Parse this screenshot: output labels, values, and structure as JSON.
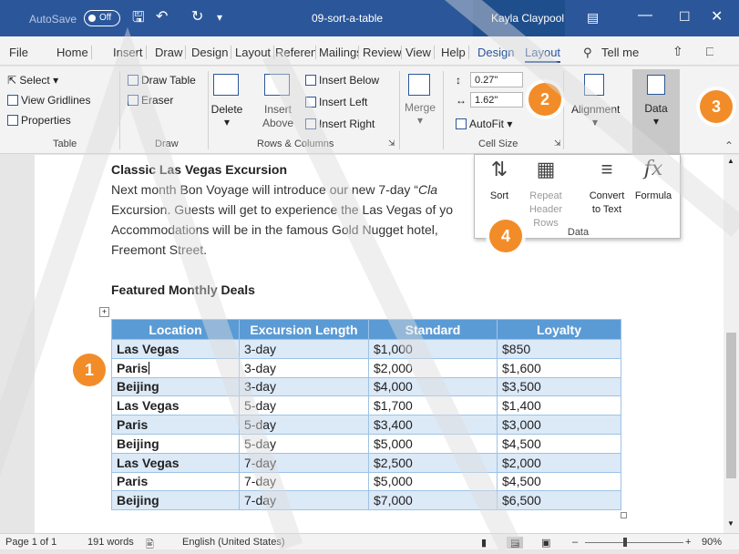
{
  "titlebar": {
    "autosave_label": "AutoSave",
    "autosave_state": "Off",
    "doc_title": "09-sort-a-table",
    "user_name": "Kayla Claypool"
  },
  "tabs": [
    "File",
    "Home",
    "Insert",
    "Draw",
    "Design",
    "Layout",
    "References",
    "Mailings",
    "Review",
    "View",
    "Help",
    "Design",
    "Layout",
    "Tell me"
  ],
  "ribbon": {
    "table": {
      "select": "Select",
      "view_gridlines": "View Gridlines",
      "properties": "Properties",
      "group": "Table"
    },
    "draw": {
      "draw_table": "Draw Table",
      "eraser": "Eraser",
      "group": "Draw"
    },
    "rows_cols": {
      "delete": "Delete",
      "insert_above": "Insert Above",
      "insert_below": "Insert Below",
      "insert_left": "Insert Left",
      "insert_right": "Insert Right",
      "group": "Rows & Columns"
    },
    "merge": {
      "label": "Merge"
    },
    "cell_size": {
      "height": "0.27\"",
      "width": "1.62\"",
      "autofit": "AutoFit",
      "group": "Cell Size"
    },
    "alignment": {
      "label": "Alignment"
    },
    "data": {
      "label": "Data"
    }
  },
  "data_menu": {
    "sort": "Sort",
    "repeat_header_rows": "Repeat Header Rows",
    "convert_to_text": "Convert to Text",
    "formula": "Formula",
    "group": "Data"
  },
  "document": {
    "heading": "Classic Las Vegas Excursion",
    "line1_a": "Next month Bon Voyage will introduce our new 7-day “",
    "line1_b": "Cla",
    "line2": "Excursion. Guests will get to experience the Las Vegas of yo",
    "line3": "Accommodations will be in the famous Gold Nugget hotel,",
    "line4": "Freemont Street.",
    "table_title": "Featured Monthly Deals",
    "table": {
      "headers": [
        "Location",
        "Excursion Length",
        "Standard",
        "Loyalty"
      ],
      "rows": [
        [
          "Las Vegas",
          "3-day",
          "$1,000",
          "$850"
        ],
        [
          "Paris",
          "3-day",
          "$2,000",
          "$1,600"
        ],
        [
          "Beijing",
          "3-day",
          "$4,000",
          "$3,500"
        ],
        [
          "Las Vegas",
          "5-day",
          "$1,700",
          "$1,400"
        ],
        [
          "Paris",
          "5-day",
          "$3,400",
          "$3,000"
        ],
        [
          "Beijing",
          "5-day",
          "$5,000",
          "$4,500"
        ],
        [
          "Las Vegas",
          "7-day",
          "$2,500",
          "$2,000"
        ],
        [
          "Paris",
          "7-day",
          "$5,000",
          "$4,500"
        ],
        [
          "Beijing",
          "7-day",
          "$7,000",
          "$6,500"
        ]
      ]
    }
  },
  "statusbar": {
    "page": "Page 1 of 1",
    "words": "191 words",
    "language": "English (United States)",
    "zoom": "90%"
  },
  "callouts": [
    "1",
    "2",
    "3",
    "4"
  ],
  "colors": {
    "accent": "#2b579a",
    "header_fill": "#5b9bd5",
    "band_fill": "#dce9f7",
    "callout": "#f28c28"
  }
}
